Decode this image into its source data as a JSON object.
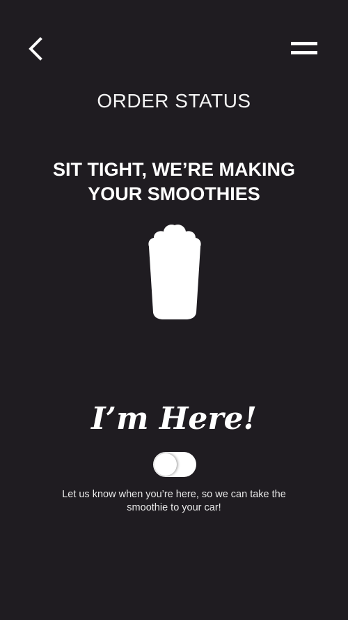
{
  "header": {
    "back_icon": "chevron-left-icon",
    "menu_icon": "hamburger-menu-icon",
    "title": "ORDER STATUS"
  },
  "status": {
    "headline": "SIT TIGHT, WE’RE MAKING YOUR SMOOTHIES",
    "illustration_icon": "smoothie-cup-icon"
  },
  "arrival": {
    "title": "I’m Here!",
    "toggle_state": "off",
    "helper_text": "Let us know when you’re here, so we can take the smoothie to your car!"
  },
  "colors": {
    "background": "#1f1c21",
    "foreground": "#ffffff"
  }
}
